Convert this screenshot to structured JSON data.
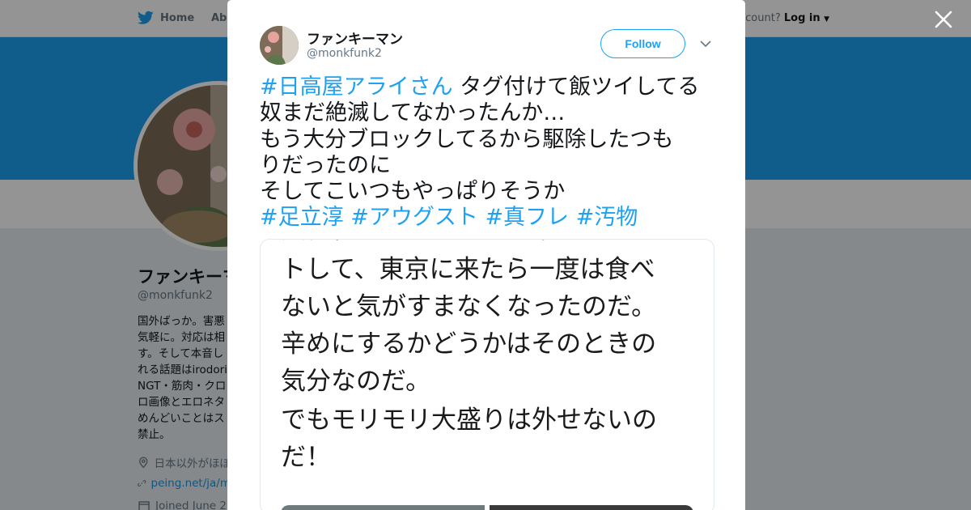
{
  "background_page": {
    "nav": {
      "home_label": "Home",
      "about_label": "Abo",
      "account_prompt": "ccount?",
      "login_label": "Log in"
    },
    "profile": {
      "name": "ファンキーマン",
      "handle": "@monkfunk2",
      "bio_lines": [
        "国外ばっか。害悪",
        "気軽に。対応は相",
        "す。そして本音し",
        "れる話題はirodori",
        "NGT・筋肉・クロ",
        "ロ画像とエロネタ",
        "めんどいことはス",
        "禁止。"
      ],
      "location": "日本以外がほぼ",
      "website": "peing.net/ja/m",
      "joined": "Joined June 2"
    }
  },
  "modal": {
    "close_icon": "close-icon",
    "author": {
      "name": "ファンキーマン",
      "handle": "@monkfunk2"
    },
    "follow_label": "Follow",
    "tweet": {
      "line1_hashtag": "#日高屋アライさん",
      "line1_text": " タグ付けて飯ツイしてる",
      "line2": "奴まだ絶滅してなかったんか…",
      "line3": "もう大分ブロックしてるから駆除したつも",
      "line4": "りだったのに",
      "line5": "そしてこいつもやっぱりそうか",
      "hashtags": [
        "#足立淳",
        "#アウグスト",
        "#真フレ",
        "#汚物"
      ]
    },
    "media_text": {
      "clipped_top": "大日程で通はそれはジャストミー",
      "lines": [
        "トして、東京に来たら一度は食べ",
        "ないと気がすまなくなったのだ。",
        "辛めにするかどうかはそのときの",
        "気分なのだ。",
        "でもモリモリ大盛りは外せないの",
        "だ！"
      ]
    }
  },
  "colors": {
    "brand": "#1da1f2",
    "link": "#1b95e0",
    "text": "#14171a",
    "muted": "#657786"
  }
}
